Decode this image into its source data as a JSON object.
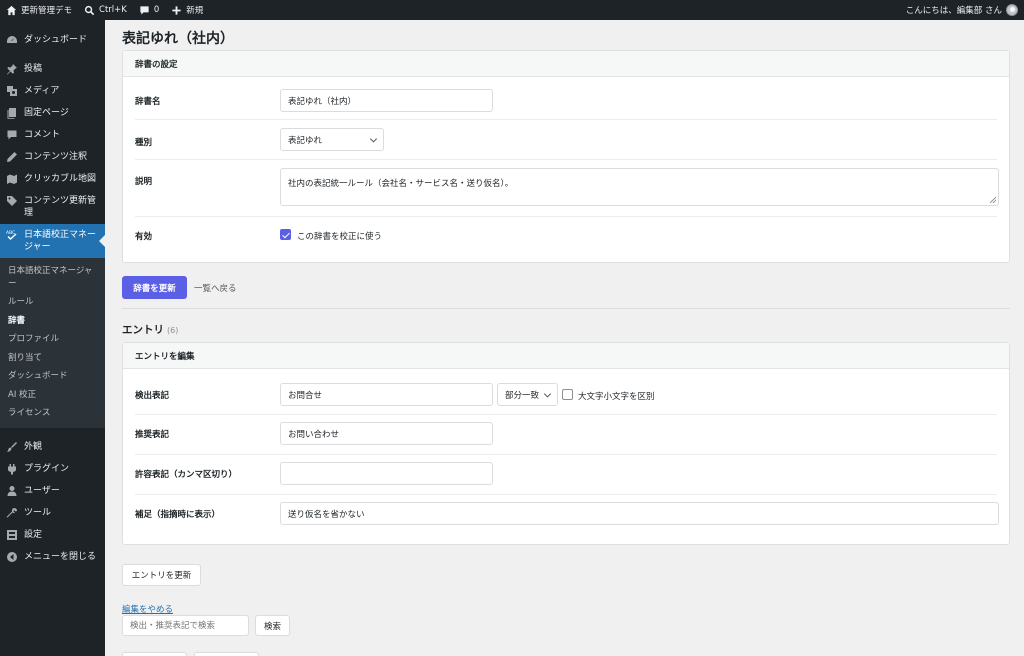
{
  "adminbar": {
    "site_name": "更新管理デモ",
    "search_shortcut": "Ctrl+K",
    "comments_count": "0",
    "new_label": "新規",
    "greeting": "こんにちは、編集部 さん"
  },
  "sidebar": {
    "items": [
      {
        "label": "ダッシュボード",
        "icon": "dashboard-icon"
      },
      {
        "label": "投稿",
        "icon": "pin-icon"
      },
      {
        "label": "メディア",
        "icon": "media-icon"
      },
      {
        "label": "固定ページ",
        "icon": "page-icon"
      },
      {
        "label": "コメント",
        "icon": "comment-icon"
      },
      {
        "label": "コンテンツ注釈",
        "icon": "pencil-icon"
      },
      {
        "label": "クリッカブル地図",
        "icon": "map-icon"
      },
      {
        "label": "コンテンツ更新管理",
        "icon": "tag-icon"
      },
      {
        "label": "日本語校正マネージャー",
        "icon": "spellcheck-icon"
      }
    ],
    "submenu": [
      {
        "label": "日本語校正マネージャー"
      },
      {
        "label": "ルール"
      },
      {
        "label": "辞書"
      },
      {
        "label": "プロファイル"
      },
      {
        "label": "割り当て"
      },
      {
        "label": "ダッシュボード"
      },
      {
        "label": "AI 校正"
      },
      {
        "label": "ライセンス"
      }
    ],
    "lower_items": [
      {
        "label": "外観",
        "icon": "brush-icon"
      },
      {
        "label": "プラグイン",
        "icon": "plugin-icon"
      },
      {
        "label": "ユーザー",
        "icon": "user-icon"
      },
      {
        "label": "ツール",
        "icon": "wrench-icon"
      },
      {
        "label": "設定",
        "icon": "settings-icon"
      },
      {
        "label": "メニューを閉じる",
        "icon": "collapse-icon"
      }
    ]
  },
  "page": {
    "title": "表記ゆれ（社内）"
  },
  "dict_settings": {
    "heading": "辞書の設定",
    "name_label": "辞書名",
    "name_value": "表記ゆれ（社内）",
    "type_label": "種別",
    "type_value": "表記ゆれ",
    "desc_label": "説明",
    "desc_value": "社内の表記統一ルール（会社名・サービス名・送り仮名）。",
    "enabled_label": "有効",
    "enabled_checkbox_label": "この辞書を校正に使う",
    "enabled": true
  },
  "dict_actions": {
    "update_button": "辞書を更新",
    "back_link": "一覧へ戻る"
  },
  "entries": {
    "title": "エントリ",
    "count": "(6)"
  },
  "entry_edit": {
    "heading": "エントリを編集",
    "detect_label": "検出表記",
    "detect_value": "お問合せ",
    "match_value": "部分一致",
    "case_label": "大文字小文字を区別",
    "case_checked": false,
    "recommend_label": "推奨表記",
    "recommend_value": "お問い合わせ",
    "allowed_label": "許容表記（カンマ区切り）",
    "allowed_value": "",
    "note_label": "補足（指摘時に表示）",
    "note_value": "送り仮名を省かない"
  },
  "entry_actions": {
    "update_button": "エントリを更新",
    "cancel_link": "編集をやめる",
    "search_placeholder": "検出・推奨表記で検索",
    "search_button": "検索"
  },
  "colors": {
    "primary": "#5b5fe5",
    "sidebar_bg": "#1d2327",
    "sidebar_current": "#2271b1",
    "link": "#2271b1"
  }
}
